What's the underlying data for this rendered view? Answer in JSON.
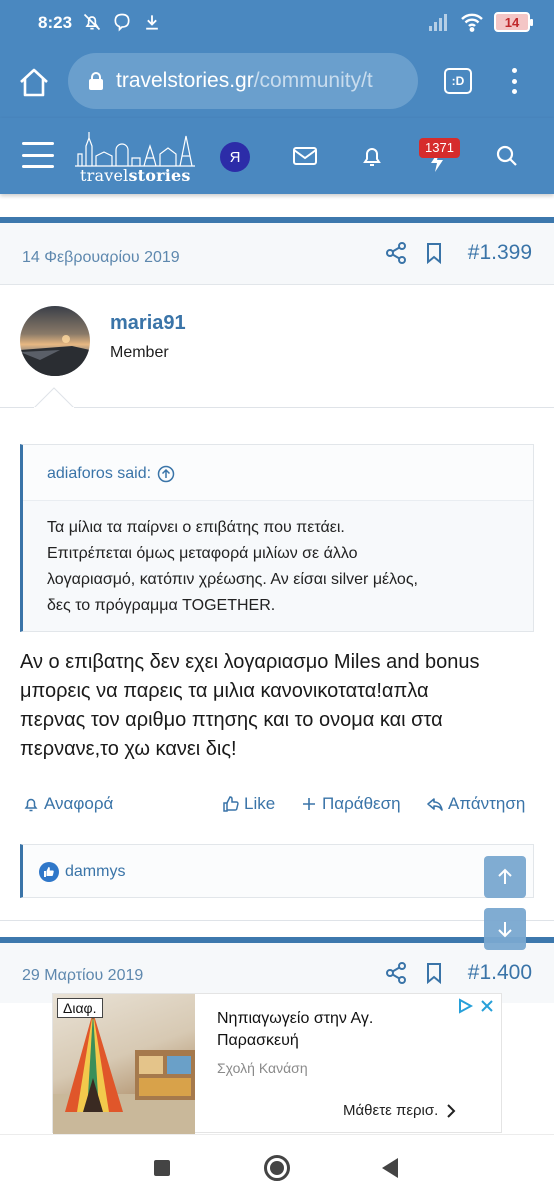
{
  "status_bar": {
    "time": "8:23",
    "battery": "14"
  },
  "browser": {
    "url_domain": "travelstories.gr",
    "url_path": "/community/t",
    "tabs_label": ":D"
  },
  "site_header": {
    "logo_text_regular": "travel",
    "logo_text_bold": "stories",
    "avatar_letter": "Я",
    "alerts_count": "1371"
  },
  "post": {
    "date": "14 Φεβρουαρίου 2019",
    "number": "#1.399",
    "user": {
      "name": "maria91",
      "title": "Member"
    },
    "quote": {
      "author": "adiaforos said:",
      "lines": [
        "Τα μίλια τα παίρνει ο επιβάτης που πετάει.",
        "Επιτρέπεται όμως μεταφορά μιλίων σε άλλο",
        "λογαριασμό, κατόπιν χρέωσης. Αν είσαι silver μέλος,",
        "δες το πρόγραμμα TOGETHER."
      ]
    },
    "body_lines": [
      "Αν ο επιβατης δεν εχει λογαριασμο Miles and bonus",
      "μπορεις να παρεις τα μιλια κανονικοτατα!απλα",
      "περνας τον αριθμο πτησης και το ονομα και στα",
      "περνανε,το χω κανει δις!"
    ],
    "actions": {
      "report": "Αναφορά",
      "like": "Like",
      "quote": "Παράθεση",
      "reply": "Απάντηση"
    },
    "liked_by": "dammys"
  },
  "post2": {
    "date": "29 Μαρτίου 2019",
    "number": "#1.400"
  },
  "ad": {
    "label": "Διαφ.",
    "title": "Νηπιαγωγείο στην Αγ. Παρασκευή",
    "sponsor": "Σχολή Κανάση",
    "cta": "Μάθετε περισ."
  },
  "colors": {
    "header_blue": "#4a88c0",
    "link_blue": "#3a74a8",
    "badge_red": "#d62c2c"
  }
}
